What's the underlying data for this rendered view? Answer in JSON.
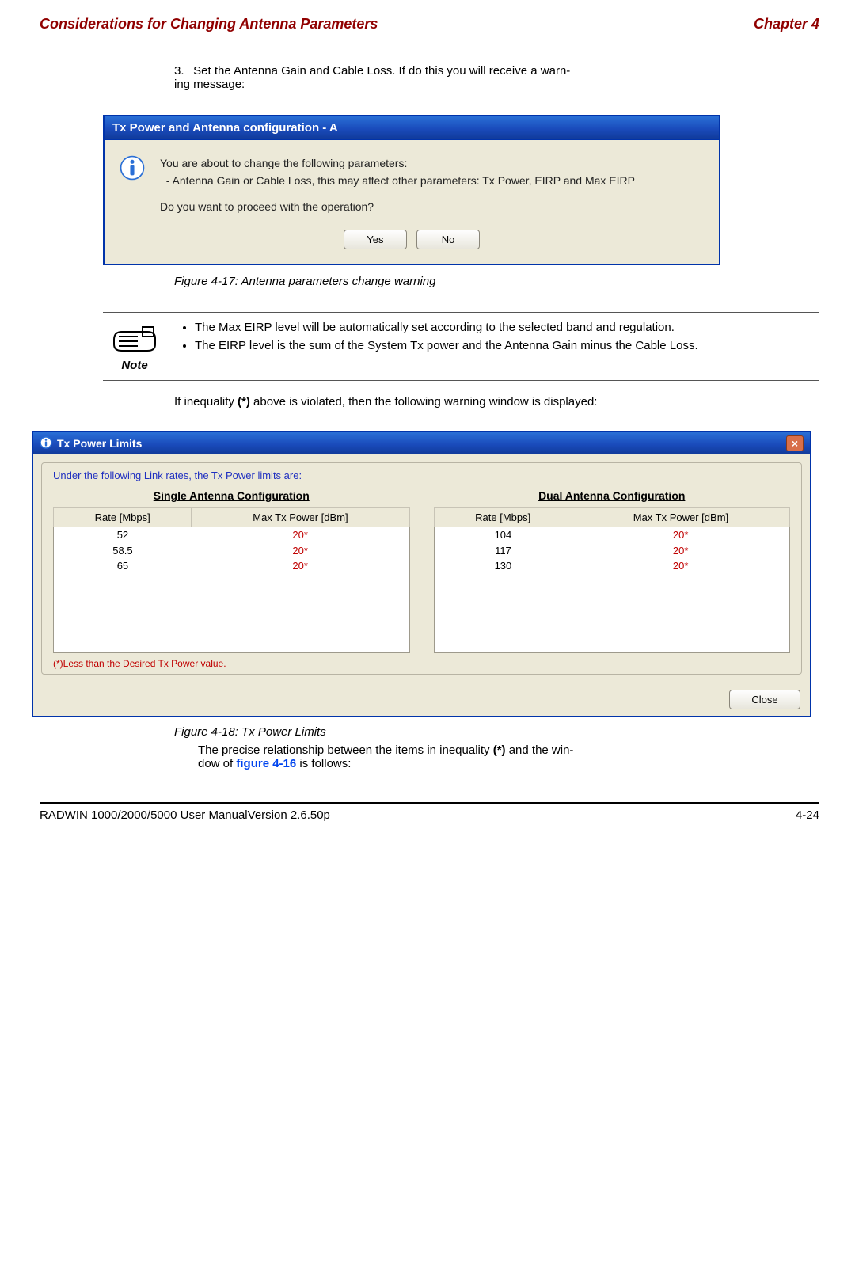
{
  "header": {
    "section": "Considerations for Changing Antenna Parameters",
    "chapter": "Chapter 4"
  },
  "step": {
    "number": "3.",
    "text": "Set the Antenna Gain and Cable Loss. If do this you will receive a warn-\ning message:"
  },
  "dialog1": {
    "title": "Tx Power and Antenna configuration - A",
    "line1": "You are about to change the following parameters:",
    "line2": "  - Antenna Gain or Cable Loss, this may affect other parameters: Tx Power, EIRP and Max EIRP",
    "line3": "Do you want to proceed with the operation?",
    "yes": "Yes",
    "no": "No"
  },
  "captions": {
    "fig17": "Figure 4-17: Antenna parameters change warning",
    "fig18": "Figure 4-18: Tx Power Limits"
  },
  "note": {
    "label": "Note",
    "bullet1": "The Max EIRP level will be automatically set according to the selected band and regulation.",
    "bullet2": "The EIRP level is the sum of the System Tx power and the Antenna Gain minus the Cable Loss."
  },
  "inequality": {
    "pre": "If inequality ",
    "bold": "(*)",
    "post": " above is violated, then the following warning window is displayed:"
  },
  "dialog2": {
    "title": "Tx Power Limits",
    "linkrates": "Under the following Link rates, the Tx Power limits are:",
    "single_title": "Single Antenna Configuration",
    "dual_title": "Dual Antenna Configuration",
    "col_rate": "Rate [Mbps]",
    "col_max": "Max Tx Power [dBm]",
    "single": {
      "r1": "52",
      "r2": "58.5",
      "r3": "65",
      "p1": "20*",
      "p2": "20*",
      "p3": "20*"
    },
    "dual": {
      "r1": "104",
      "r2": "117",
      "r3": "130",
      "p1": "20*",
      "p2": "20*",
      "p3": "20*"
    },
    "lessnote": "(*)Less than the Desired Tx Power value.",
    "close": "Close"
  },
  "precise": {
    "pre": "The precise relationship between the items in inequality ",
    "bold": "(*)",
    "mid": " and the win-\ndow of ",
    "link": "figure 4-16",
    "post": " is follows:"
  },
  "footer": {
    "manual": "RADWIN 1000/2000/5000 User ManualVersion  2.6.50p",
    "page": "4-24"
  }
}
